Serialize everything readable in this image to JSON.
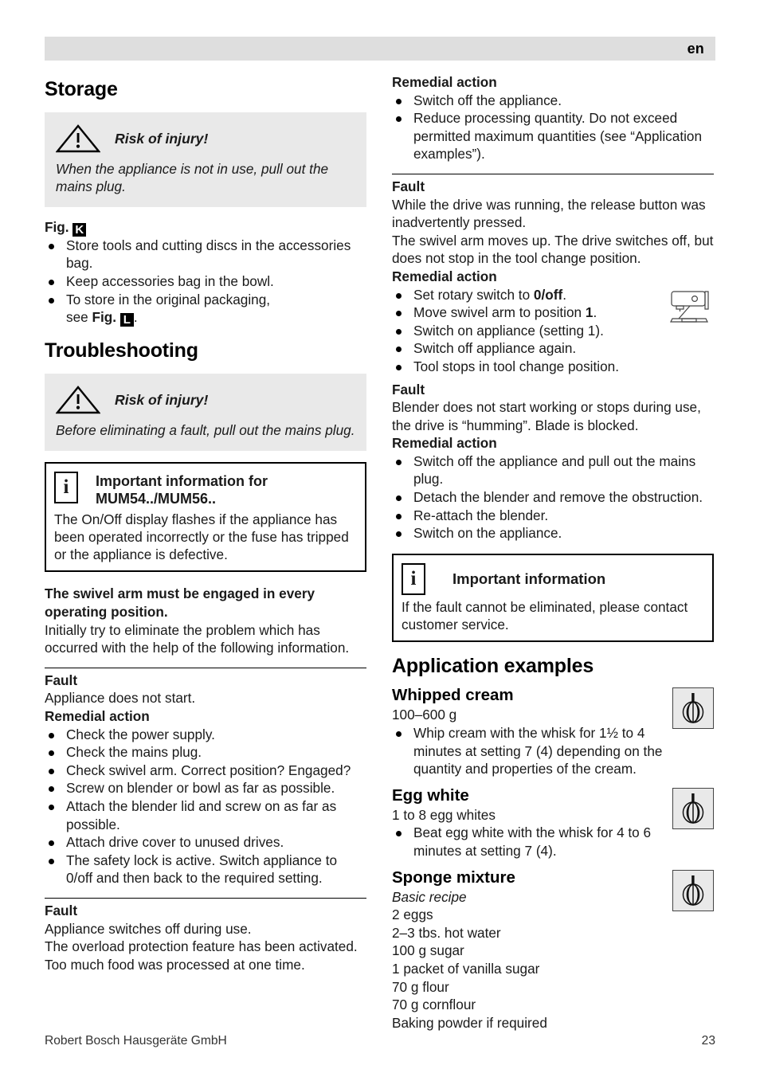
{
  "header": {
    "language": "en"
  },
  "footer": {
    "company": "Robert Bosch Hausgeräte GmbH",
    "page_number": "23"
  },
  "left_column": {
    "storage": {
      "title": "Storage",
      "warning": {
        "title": "Risk of injury!",
        "body": "When the appliance is not in use, pull out the mains plug.",
        "icon": "warning-triangle-icon"
      },
      "fig_label": "Fig.",
      "fig_marker": "K",
      "bullets": [
        "Store tools and cutting discs in the accessories bag.",
        "Keep accessories bag in the bowl.",
        "To store in the original packaging,"
      ],
      "bullet3_continuation_prefix": "see ",
      "bullet3_fig_label": "Fig.",
      "bullet3_fig_marker": "L",
      "bullet3_suffix": "."
    },
    "troubleshooting": {
      "title": "Troubleshooting",
      "warning": {
        "title": "Risk of injury!",
        "body": "Before eliminating a fault, pull out the mains plug.",
        "icon": "warning-triangle-icon"
      },
      "info_box": {
        "icon": "information-icon",
        "title_line1": "Important information for",
        "title_line2": "MUM54../MUM56..",
        "body": "The On/Off display flashes if the appliance has been operated incorrectly or the fuse has tripped or the appliance is defective."
      },
      "swivel_heading": "The swivel arm must be engaged in every operating position.",
      "swivel_body": "Initially try to eliminate the problem which has occurred with the help of the following information.",
      "faults": [
        {
          "fault_label": "Fault",
          "fault_text": "Appliance does not start.",
          "remedial_label": "Remedial action",
          "remedies": [
            "Check the power supply.",
            "Check the mains plug.",
            "Check swivel arm. Correct position? Engaged?",
            "Screw on blender or bowl as far as possible.",
            "Attach the blender lid and screw on as far as possible.",
            "Attach drive cover to unused drives.",
            "The safety lock is active. Switch appliance to 0/off and then back to the required setting."
          ]
        },
        {
          "fault_label": "Fault",
          "fault_text": "Appliance switches off during use.",
          "fault_text2": "The overload protection feature has been activated. Too much food was processed at one time."
        }
      ]
    }
  },
  "right_column": {
    "remedial_top": {
      "label": "Remedial action",
      "bullets": [
        "Switch off the appliance.",
        "Reduce processing quantity. Do not exceed permitted maximum quantities (see “Application examples”)."
      ]
    },
    "fault_release_button": {
      "fault_label": "Fault",
      "fault_text": "While the drive was running, the release button was inadvertently pressed.",
      "fault_text2": "The swivel arm moves up. The drive switches off, but does not stop in the tool change position.",
      "remedial_label": "Remedial action",
      "icon": "stand-mixer-icon",
      "remedies": [
        {
          "pre": "Set rotary switch to ",
          "bold": "0/off",
          "post": "."
        },
        {
          "pre": "Move swivel arm to position ",
          "bold": "1",
          "post": "."
        },
        {
          "pre": "Switch on appliance (setting 1).",
          "bold": "",
          "post": ""
        },
        {
          "pre": "Switch off appliance again.",
          "bold": "",
          "post": ""
        },
        {
          "pre": "Tool stops in tool change position.",
          "bold": "",
          "post": ""
        }
      ]
    },
    "fault_blender": {
      "fault_label": "Fault",
      "fault_text": "Blender does not start working or stops during use, the drive is “humming”. Blade is blocked.",
      "remedial_label": "Remedial action",
      "remedies": [
        "Switch off the appliance and pull out the mains plug.",
        "Detach the blender and remove the obstruction.",
        "Re-attach the blender.",
        "Switch on the appliance."
      ]
    },
    "info_box": {
      "icon": "information-icon",
      "title": "Important information",
      "body": "If the fault cannot be eliminated, please contact customer service."
    },
    "application_examples": {
      "title": "Application examples",
      "recipes": [
        {
          "name": "Whipped cream",
          "quantity": "100–600 g",
          "icon": "whisk-icon",
          "bullets": [
            "Whip cream with the whisk for 1½ to 4 minutes at setting 7 (4) depending on the quantity and properties of the cream."
          ]
        },
        {
          "name": "Egg white",
          "quantity": "1 to 8 egg whites",
          "icon": "whisk-icon",
          "bullets": [
            "Beat egg white with the whisk for 4 to 6 minutes at setting 7 (4)."
          ]
        },
        {
          "name": "Sponge mixture",
          "subtitle": "Basic recipe",
          "icon": "whisk-icon",
          "ingredients": [
            "2 eggs",
            "2–3 tbs. hot water",
            "100 g sugar",
            "1 packet of vanilla sugar",
            "70 g flour",
            "70 g cornflour",
            "Baking powder if required"
          ]
        }
      ]
    }
  }
}
